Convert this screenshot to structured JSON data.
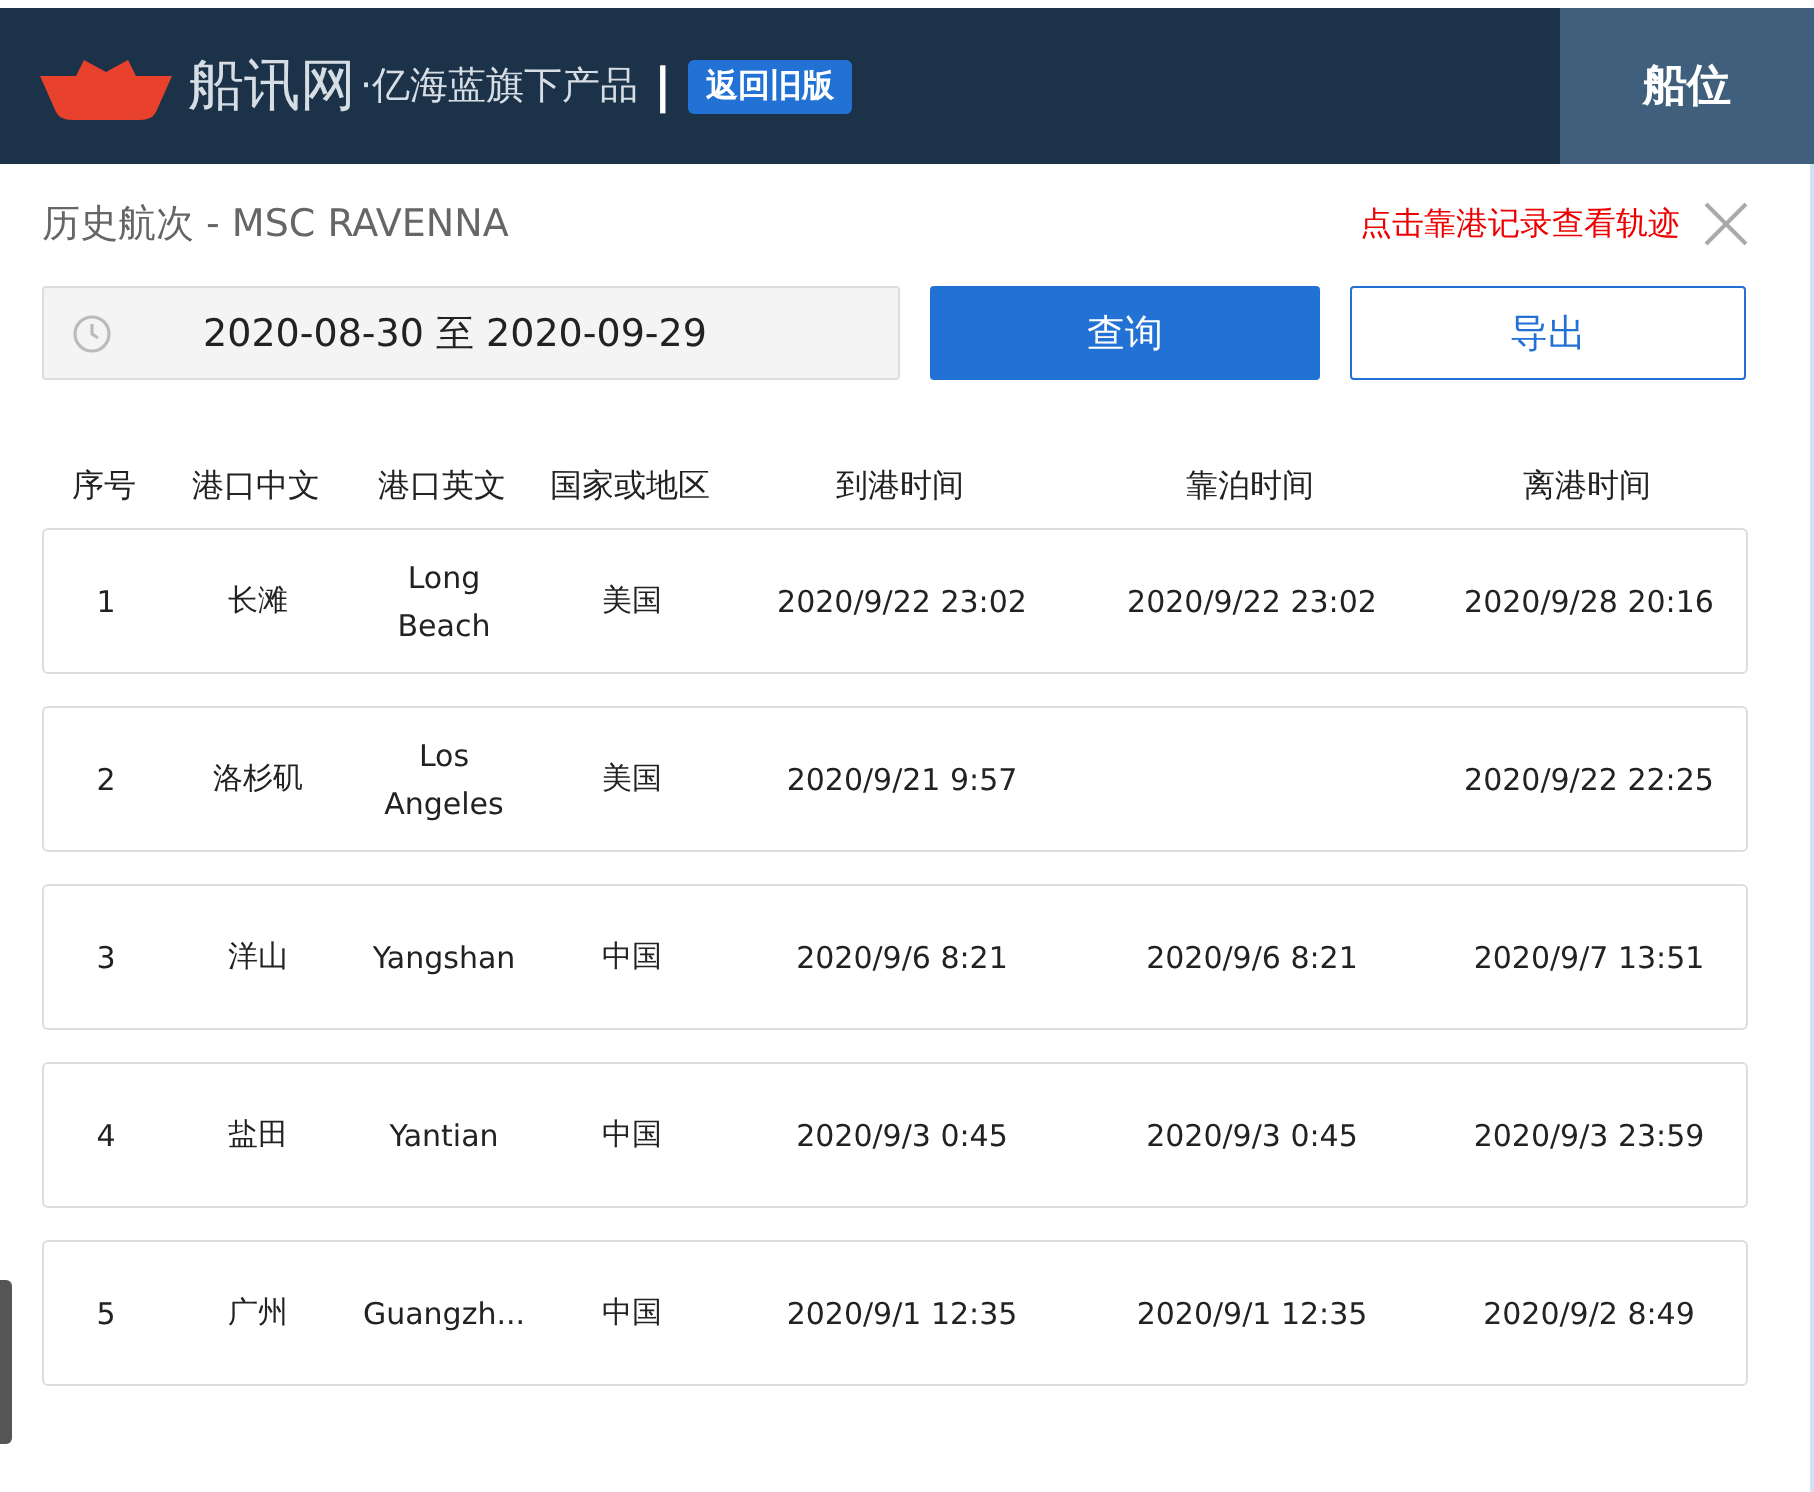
{
  "header": {
    "brand": "船讯网",
    "tagline": "·亿海蓝旗下产品",
    "separator": "|",
    "old_version_button": "返回旧版",
    "tab": "船位"
  },
  "panel": {
    "title": "历史航次 - MSC RAVENNA",
    "hint": "点击靠港记录查看轨迹"
  },
  "filters": {
    "date_range": "2020-08-30 至 2020-09-29",
    "query_button": "查询",
    "export_button": "导出"
  },
  "table": {
    "columns": [
      "序号",
      "港口中文",
      "港口英文",
      "国家或地区",
      "到港时间",
      "靠泊时间",
      "离港时间"
    ],
    "rows": [
      {
        "no": "1",
        "port_cn": "长滩",
        "port_en": "Long Beach",
        "country": "美国",
        "arrival": "2020/9/22 23:02",
        "berth": "2020/9/22 23:02",
        "departure": "2020/9/28 20:16"
      },
      {
        "no": "2",
        "port_cn": "洛杉矶",
        "port_en": "Los Angeles",
        "country": "美国",
        "arrival": "2020/9/21 9:57",
        "departure": "2020/9/22 22:25"
      },
      {
        "no": "3",
        "port_cn": "洋山",
        "port_en": "Yangshan",
        "country": "中国",
        "arrival": "2020/9/6 8:21",
        "berth": "2020/9/6 8:21",
        "departure": "2020/9/7 13:51"
      },
      {
        "no": "4",
        "port_cn": "盐田",
        "port_en": "Yantian",
        "country": "中国",
        "arrival": "2020/9/3 0:45",
        "berth": "2020/9/3 0:45",
        "departure": "2020/9/3 23:59"
      },
      {
        "no": "5",
        "port_cn": "广州",
        "port_en": "Guangzh...",
        "country": "中国",
        "arrival": "2020/9/1 12:35",
        "berth": "2020/9/1 12:35",
        "departure": "2020/9/2 8:49"
      }
    ]
  }
}
